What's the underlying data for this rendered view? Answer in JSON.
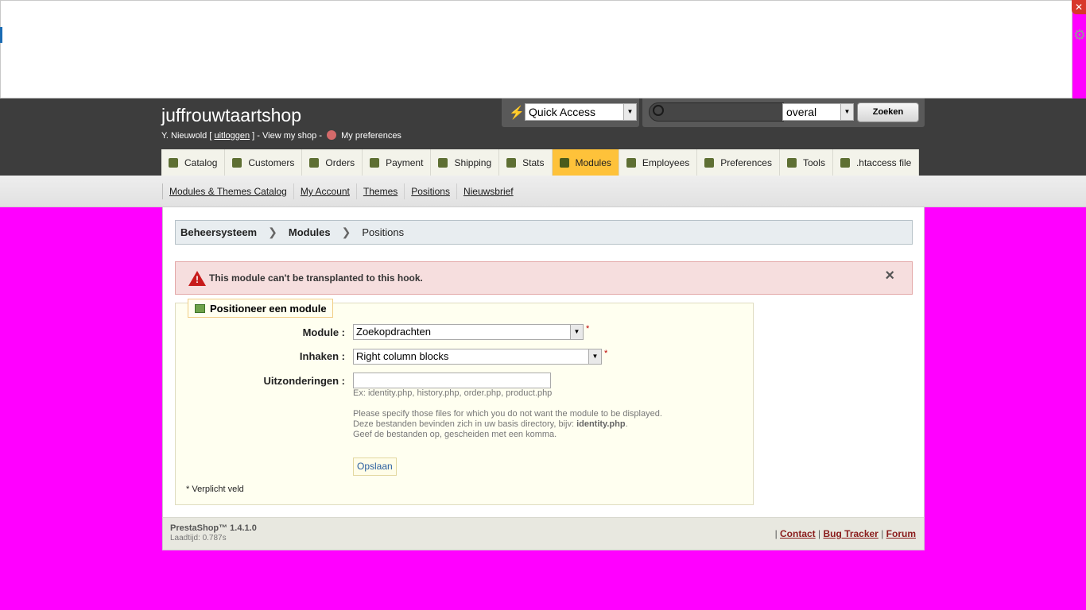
{
  "header": {
    "shop_name": "juffrouwtaartshop",
    "user_name": "Y. Nieuwold",
    "logout_label": "uitloggen",
    "view_shop": "View my shop",
    "preferences": "My preferences"
  },
  "quick_access": {
    "selected": "Quick Access"
  },
  "search": {
    "query": "",
    "scope": "overal",
    "button": "Zoeken"
  },
  "tabs": [
    {
      "label": "Catalog",
      "icon": "catalog-icon",
      "active": false
    },
    {
      "label": "Customers",
      "icon": "customers-icon",
      "active": false
    },
    {
      "label": "Orders",
      "icon": "cart-icon",
      "active": false
    },
    {
      "label": "Payment",
      "icon": "payment-icon",
      "active": false
    },
    {
      "label": "Shipping",
      "icon": "truck-icon",
      "active": false
    },
    {
      "label": "Stats",
      "icon": "stats-icon",
      "active": false
    },
    {
      "label": "Modules",
      "icon": "puzzle-icon",
      "active": true
    },
    {
      "label": "Employees",
      "icon": "employees-icon",
      "active": false
    },
    {
      "label": "Preferences",
      "icon": "sliders-icon",
      "active": false
    },
    {
      "label": "Tools",
      "icon": "tools-icon",
      "active": false
    },
    {
      "label": ".htaccess file",
      "icon": "file-icon",
      "active": false
    }
  ],
  "subnav": [
    {
      "label": "Modules & Themes Catalog"
    },
    {
      "label": "My Account"
    },
    {
      "label": "Themes"
    },
    {
      "label": "Positions"
    },
    {
      "label": "Nieuwsbrief"
    }
  ],
  "breadcrumb": {
    "root": "Beheersysteem",
    "section": "Modules",
    "current": "Positions"
  },
  "alert": {
    "message": "This module can't be transplanted to this hook."
  },
  "form": {
    "legend": "Positioneer een module",
    "module_label": "Module :",
    "module_value": "Zoekopdrachten",
    "hook_label": "Inhaken :",
    "hook_value": "Right column blocks",
    "exceptions_label": "Uitzonderingen :",
    "exceptions_value": "",
    "example": "Ex: identity.php, history.php, order.php, product.php",
    "help_line1": "Please specify those files for which you do not want the module to be displayed.",
    "help_line2": "Deze bestanden bevinden zich in uw basis directory, bijv: ",
    "help_line2_bold": "identity.php",
    "help_line3": "Geef de bestanden op, gescheiden met een komma.",
    "save": "Opslaan",
    "required_note": "* Verplicht veld",
    "required_mark": "*"
  },
  "footer": {
    "version": "PrestaShop™ 1.4.1.0",
    "load_time": "Laadtijd: 0.787s",
    "contact": "Contact",
    "bug_tracker": "Bug Tracker",
    "forum": "Forum"
  },
  "colors": {
    "accent_tab": "#fec23a",
    "background": "#ff00ff",
    "alert_bg": "#f6dede"
  }
}
